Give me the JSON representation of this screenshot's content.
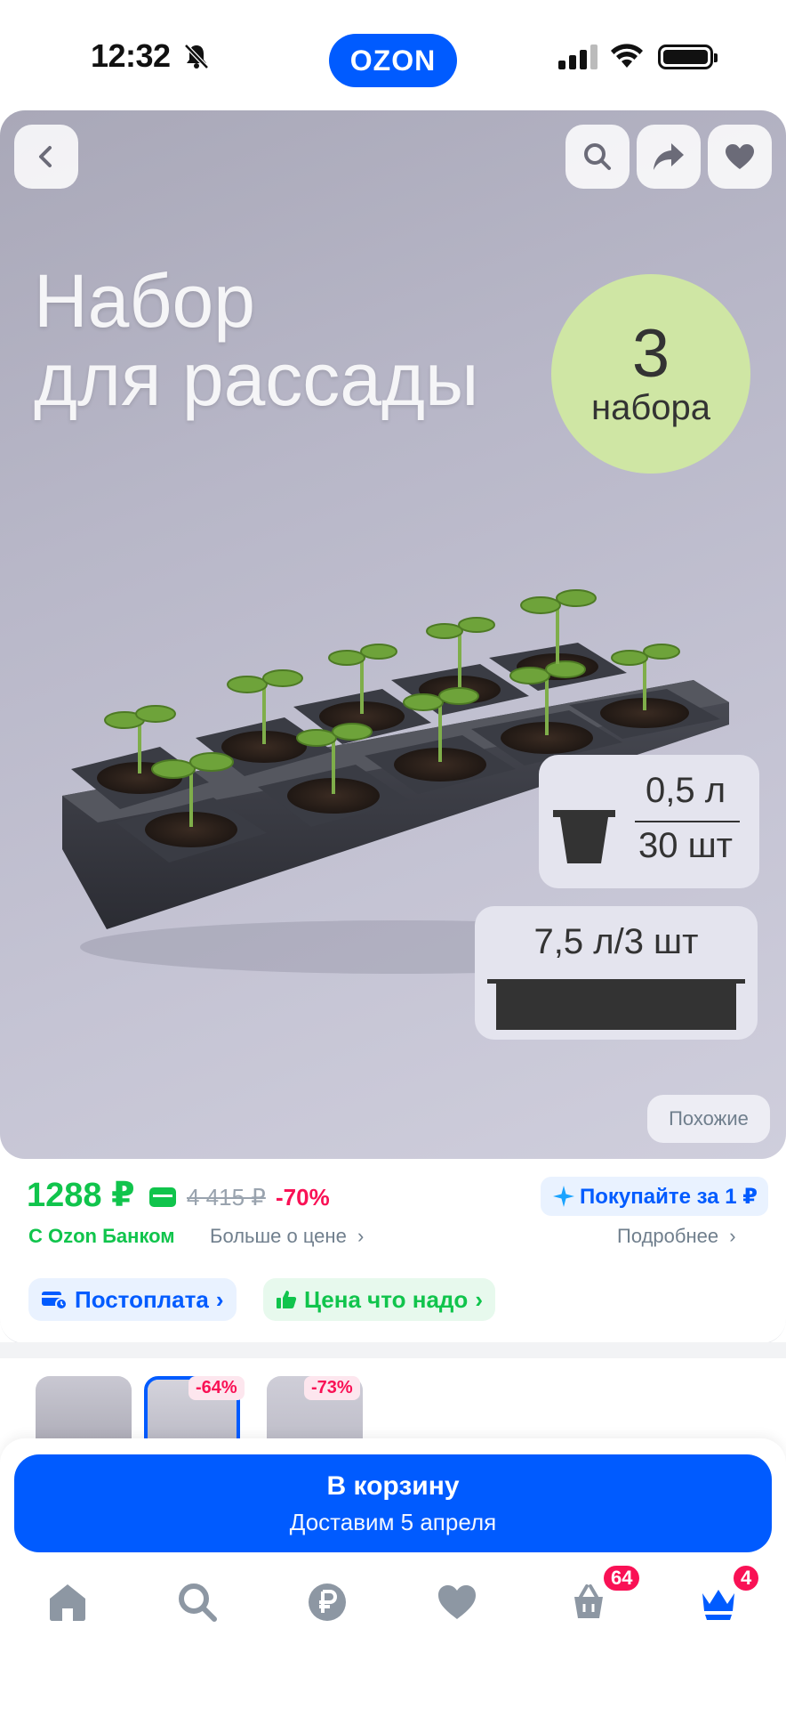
{
  "status_bar": {
    "time": "12:32",
    "logo": "OZON"
  },
  "hero": {
    "title_line1": "Набор",
    "title_line2": "для рассады",
    "badge_number": "3",
    "badge_word": "набора",
    "pot_volume": "0,5 л",
    "pot_count": "30 шт",
    "tray_spec": "7,5 л/3 шт",
    "similar_label": "Похожие"
  },
  "price": {
    "current": "1288 ₽",
    "old": "4 415 ₽",
    "discount": "-70%",
    "bank_note": "С Ozon Банком",
    "more_about_price": "Больше о цене",
    "buy_for_one": "Покупайте за 1 ₽",
    "details": "Подробнее"
  },
  "chips": {
    "postpay": "Постоплата",
    "fair_price": "Цена что надо"
  },
  "variants": [
    {
      "tag": ""
    },
    {
      "tag": "-64%"
    },
    {
      "tag": "-73%"
    }
  ],
  "cta": {
    "title": "В корзину",
    "subtitle": "Доставим 5 апреля"
  },
  "tabbar": {
    "cart_badge": "64",
    "profile_badge": "4"
  },
  "colors": {
    "brand_blue": "#005bff",
    "price_green": "#10c44c",
    "discount_red": "#f91155"
  }
}
